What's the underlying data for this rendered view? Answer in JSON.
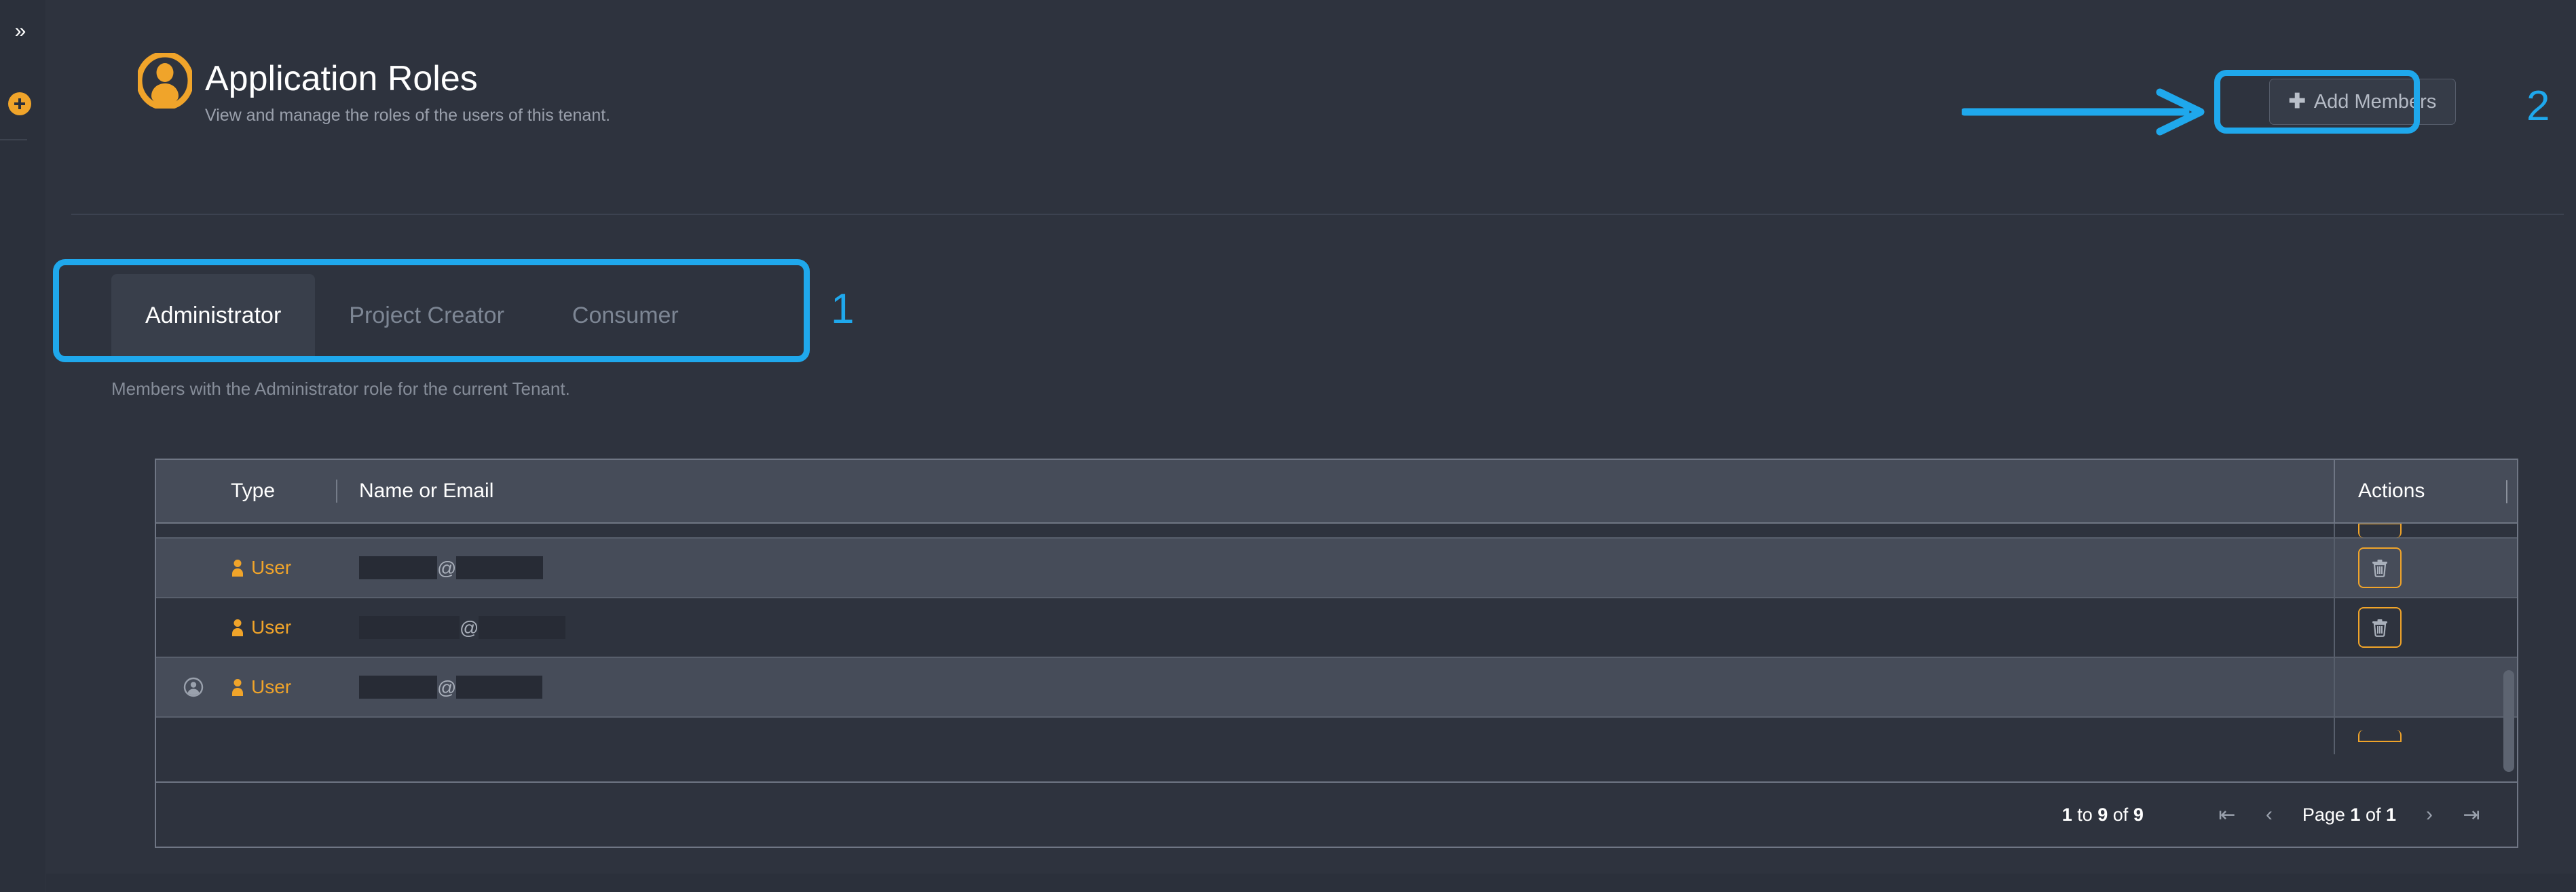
{
  "rail": {
    "expand_icon": "chevron-double-right-icon",
    "add_icon": "plus-circle-icon"
  },
  "header": {
    "icon": "user-avatar-icon",
    "title": "Application Roles",
    "subtitle": "View and manage the roles of the users of this tenant.",
    "add_members": {
      "icon": "plus-icon",
      "label": "Add Members"
    }
  },
  "tabs": {
    "items": [
      {
        "label": "Administrator",
        "active": true
      },
      {
        "label": "Project Creator",
        "active": false
      },
      {
        "label": "Consumer",
        "active": false
      }
    ],
    "description": "Members with the Administrator role for the current Tenant."
  },
  "table": {
    "columns": [
      "Type",
      "Name or Email",
      "Actions"
    ],
    "rows": [
      {
        "avatar": "",
        "type": "",
        "type_icon": "",
        "email_local_width": 0,
        "email_domain_width": 0,
        "action_icon": "trash-icon",
        "clipped": "top",
        "shade": "dark"
      },
      {
        "avatar": "",
        "type": "User",
        "type_icon": "user-icon",
        "email_local_width": 182,
        "email_domain_width": 212,
        "action_icon": "trash-icon",
        "clipped": "",
        "shade": "light"
      },
      {
        "avatar": "",
        "type": "User",
        "type_icon": "user-icon",
        "email_local_width": 222,
        "email_domain_width": 228,
        "action_icon": "trash-icon",
        "clipped": "",
        "shade": "dark"
      },
      {
        "avatar": "account-circle-icon",
        "type": "User",
        "type_icon": "user-icon",
        "email_local_width": 182,
        "email_domain_width": 210,
        "action_icon": "",
        "clipped": "",
        "shade": "light"
      },
      {
        "avatar": "",
        "type": "",
        "type_icon": "",
        "email_local_width": 0,
        "email_domain_width": 0,
        "action_icon": "trash-icon",
        "clipped": "bottom",
        "shade": "dark"
      }
    ],
    "at_symbol": "@",
    "scrollbar": "vertical-scrollbar-thumb"
  },
  "pagination": {
    "summary_prefix": "1",
    "summary": "1 to 9 of 9",
    "first_icon": "|<",
    "prev_icon": "‹",
    "page_label": "Page 1 of 1",
    "next_icon": "›",
    "last_icon": ">|"
  },
  "annotations": {
    "one": "1",
    "two": "2",
    "arrow": "arrow-right",
    "color": "#1fa8ec"
  },
  "colors": {
    "accent_orange": "#f0a42a",
    "annotation_blue": "#1fa8ec",
    "panel_bg": "#2e333e",
    "row_light": "#464c59",
    "row_dark": "#2e333e"
  }
}
